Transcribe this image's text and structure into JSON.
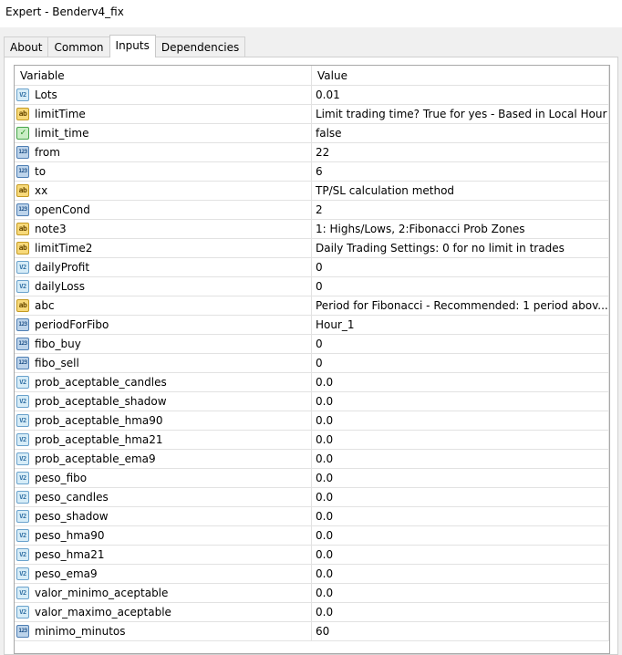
{
  "window": {
    "title": "Expert - Benderv4_fix"
  },
  "tabs": [
    "About",
    "Common",
    "Inputs",
    "Dependencies"
  ],
  "active_tab": "Inputs",
  "table": {
    "headers": {
      "variable": "Variable",
      "value": "Value"
    },
    "rows": [
      {
        "icon": "v2",
        "icon_name": "double-type-icon",
        "name": "Lots",
        "value": "0.01"
      },
      {
        "icon": "ab",
        "icon_name": "string-type-icon",
        "name": "limitTime",
        "value": "Limit trading time? True for yes - Based in Local Hour"
      },
      {
        "icon": "bool",
        "icon_name": "bool-type-icon",
        "name": "limit_time",
        "value": "false"
      },
      {
        "icon": "n123",
        "icon_name": "integer-type-icon",
        "name": "from",
        "value": "22"
      },
      {
        "icon": "n123",
        "icon_name": "integer-type-icon",
        "name": "to",
        "value": "6"
      },
      {
        "icon": "ab",
        "icon_name": "string-type-icon",
        "name": "xx",
        "value": "TP/SL calculation method"
      },
      {
        "icon": "n123",
        "icon_name": "integer-type-icon",
        "name": "openCond",
        "value": "2"
      },
      {
        "icon": "ab",
        "icon_name": "string-type-icon",
        "name": "note3",
        "value": "1: Highs/Lows, 2:Fibonacci Prob Zones"
      },
      {
        "icon": "ab",
        "icon_name": "string-type-icon",
        "name": "limitTime2",
        "value": "Daily Trading Settings: 0 for no limit in trades"
      },
      {
        "icon": "v2",
        "icon_name": "double-type-icon",
        "name": "dailyProfit",
        "value": "0"
      },
      {
        "icon": "v2",
        "icon_name": "double-type-icon",
        "name": "dailyLoss",
        "value": "0"
      },
      {
        "icon": "ab",
        "icon_name": "string-type-icon",
        "name": "abc",
        "value": "Period for Fibonacci - Recommended: 1 period abov..."
      },
      {
        "icon": "n123",
        "icon_name": "integer-type-icon",
        "name": "periodForFibo",
        "value": "Hour_1"
      },
      {
        "icon": "n123",
        "icon_name": "integer-type-icon",
        "name": "fibo_buy",
        "value": "0"
      },
      {
        "icon": "n123",
        "icon_name": "integer-type-icon",
        "name": "fibo_sell",
        "value": "0"
      },
      {
        "icon": "v2",
        "icon_name": "double-type-icon",
        "name": "prob_aceptable_candles",
        "value": "0.0"
      },
      {
        "icon": "v2",
        "icon_name": "double-type-icon",
        "name": "prob_aceptable_shadow",
        "value": "0.0"
      },
      {
        "icon": "v2",
        "icon_name": "double-type-icon",
        "name": "prob_aceptable_hma90",
        "value": "0.0"
      },
      {
        "icon": "v2",
        "icon_name": "double-type-icon",
        "name": "prob_aceptable_hma21",
        "value": "0.0"
      },
      {
        "icon": "v2",
        "icon_name": "double-type-icon",
        "name": "prob_aceptable_ema9",
        "value": "0.0"
      },
      {
        "icon": "v2",
        "icon_name": "double-type-icon",
        "name": "peso_fibo",
        "value": "0.0"
      },
      {
        "icon": "v2",
        "icon_name": "double-type-icon",
        "name": "peso_candles",
        "value": "0.0"
      },
      {
        "icon": "v2",
        "icon_name": "double-type-icon",
        "name": "peso_shadow",
        "value": "0.0"
      },
      {
        "icon": "v2",
        "icon_name": "double-type-icon",
        "name": "peso_hma90",
        "value": "0.0"
      },
      {
        "icon": "v2",
        "icon_name": "double-type-icon",
        "name": "peso_hma21",
        "value": "0.0"
      },
      {
        "icon": "v2",
        "icon_name": "double-type-icon",
        "name": "peso_ema9",
        "value": "0.0"
      },
      {
        "icon": "v2",
        "icon_name": "double-type-icon",
        "name": "valor_minimo_aceptable",
        "value": "0.0"
      },
      {
        "icon": "v2",
        "icon_name": "double-type-icon",
        "name": "valor_maximo_aceptable",
        "value": "0.0"
      },
      {
        "icon": "n123",
        "icon_name": "integer-type-icon",
        "name": "minimo_minutos",
        "value": "60"
      }
    ]
  },
  "icon_glyphs": {
    "v2": "V2",
    "n123": "123",
    "ab": "ab",
    "bool": "✓"
  },
  "colors": {
    "active_tab": "#ffffff",
    "background": "#f0f0f0",
    "grid_border": "#a8a8a8"
  }
}
